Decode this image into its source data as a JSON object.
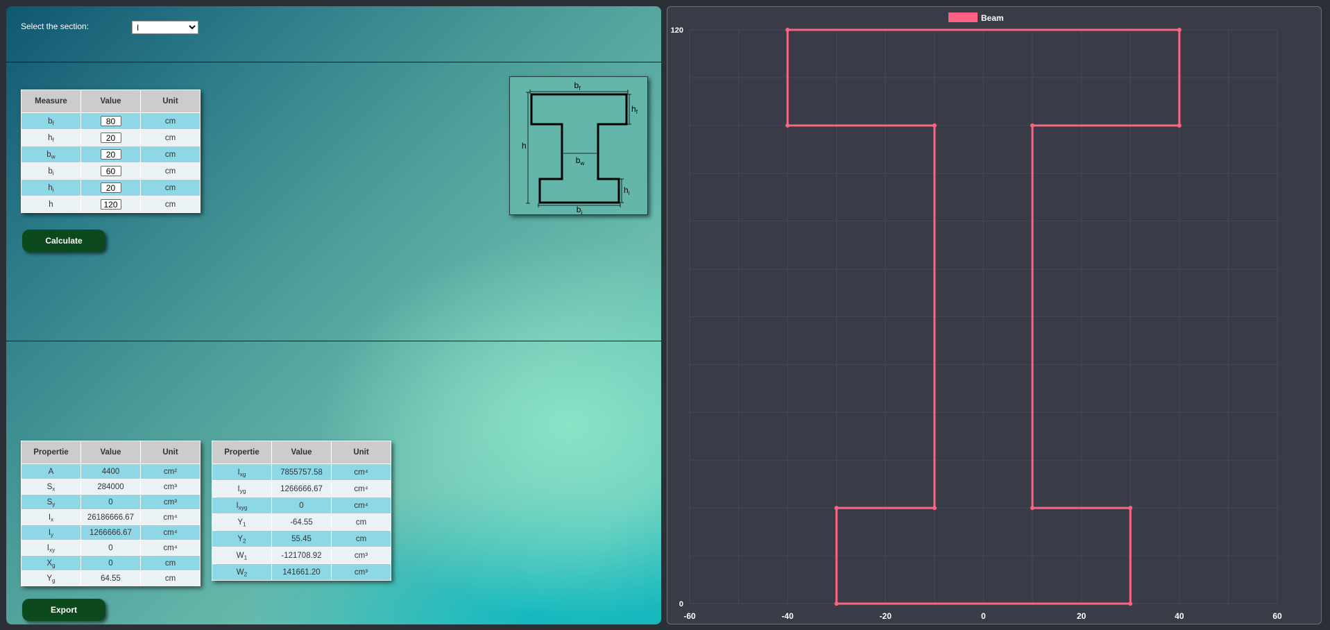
{
  "controls": {
    "select_label": "Select the section:",
    "section_value": "I"
  },
  "measures_table": {
    "headers": [
      "Measure",
      "Value",
      "Unit"
    ],
    "rows": [
      {
        "sym": "b",
        "sub": "f",
        "value": "80",
        "unit": "cm"
      },
      {
        "sym": "h",
        "sub": "f",
        "value": "20",
        "unit": "cm"
      },
      {
        "sym": "b",
        "sub": "w",
        "value": "20",
        "unit": "cm"
      },
      {
        "sym": "b",
        "sub": "i",
        "value": "60",
        "unit": "cm"
      },
      {
        "sym": "h",
        "sub": "i",
        "value": "20",
        "unit": "cm"
      },
      {
        "sym": "h",
        "sub": "",
        "value": "120",
        "unit": "cm"
      }
    ]
  },
  "buttons": {
    "calculate": "Calculate",
    "export": "Export"
  },
  "diagram_labels": {
    "bf": {
      "sym": "b",
      "sub": "f"
    },
    "hf": {
      "sym": "h",
      "sub": "f"
    },
    "h": {
      "sym": "h",
      "sub": ""
    },
    "bw": {
      "sym": "b",
      "sub": "w"
    },
    "hi": {
      "sym": "h",
      "sub": "i"
    },
    "bi": {
      "sym": "b",
      "sub": "i"
    }
  },
  "props_table_1": {
    "headers": [
      "Propertie",
      "Value",
      "Unit"
    ],
    "rows": [
      {
        "sym": "A",
        "sub": "",
        "value": "4400",
        "unit": "cm²"
      },
      {
        "sym": "S",
        "sub": "x",
        "value": "284000",
        "unit": "cm³"
      },
      {
        "sym": "S",
        "sub": "y",
        "value": "0",
        "unit": "cm³"
      },
      {
        "sym": "I",
        "sub": "x",
        "value": "26186666.67",
        "unit": "cm⁴"
      },
      {
        "sym": "I",
        "sub": "y",
        "value": "1266666.67",
        "unit": "cm⁴"
      },
      {
        "sym": "I",
        "sub": "xy",
        "value": "0",
        "unit": "cm⁴"
      },
      {
        "sym": "X",
        "sub": "g",
        "value": "0",
        "unit": "cm"
      },
      {
        "sym": "Y",
        "sub": "g",
        "value": "64.55",
        "unit": "cm"
      }
    ]
  },
  "props_table_2": {
    "headers": [
      "Propertie",
      "Value",
      "Unit"
    ],
    "rows": [
      {
        "sym": "I",
        "sub": "xg",
        "value": "7855757.58",
        "unit": "cm⁴"
      },
      {
        "sym": "I",
        "sub": "yg",
        "value": "1266666.67",
        "unit": "cm⁴"
      },
      {
        "sym": "I",
        "sub": "xyg",
        "value": "0",
        "unit": "cm⁴"
      },
      {
        "sym": "Y",
        "sub": "1",
        "value": "-64.55",
        "unit": "cm"
      },
      {
        "sym": "Y",
        "sub": "2",
        "value": "55.45",
        "unit": "cm"
      },
      {
        "sym": "W",
        "sub": "1",
        "value": "-121708.92",
        "unit": "cm³"
      },
      {
        "sym": "W",
        "sub": "2",
        "value": "141661.20",
        "unit": "cm³"
      }
    ]
  },
  "colors": {
    "series": "#ff6384",
    "chart_bg": "#393c46",
    "button": "#0c4a1e"
  },
  "chart_data": {
    "type": "line",
    "series": [
      {
        "name": "Beam",
        "points": [
          [
            -30,
            0
          ],
          [
            30,
            0
          ],
          [
            30,
            20
          ],
          [
            10,
            20
          ],
          [
            10,
            100
          ],
          [
            40,
            100
          ],
          [
            40,
            120
          ],
          [
            -40,
            120
          ],
          [
            -40,
            100
          ],
          [
            -10,
            100
          ],
          [
            -10,
            20
          ],
          [
            -30,
            20
          ],
          [
            -30,
            0
          ]
        ]
      }
    ],
    "xlim": [
      -60,
      60
    ],
    "ylim": [
      0,
      120
    ],
    "x_ticks": [
      "-60",
      "-40",
      "-20",
      "0",
      "20",
      "40",
      "60"
    ],
    "y_ticks": [
      "0",
      "120"
    ],
    "legend_position": "top",
    "grid": true
  }
}
